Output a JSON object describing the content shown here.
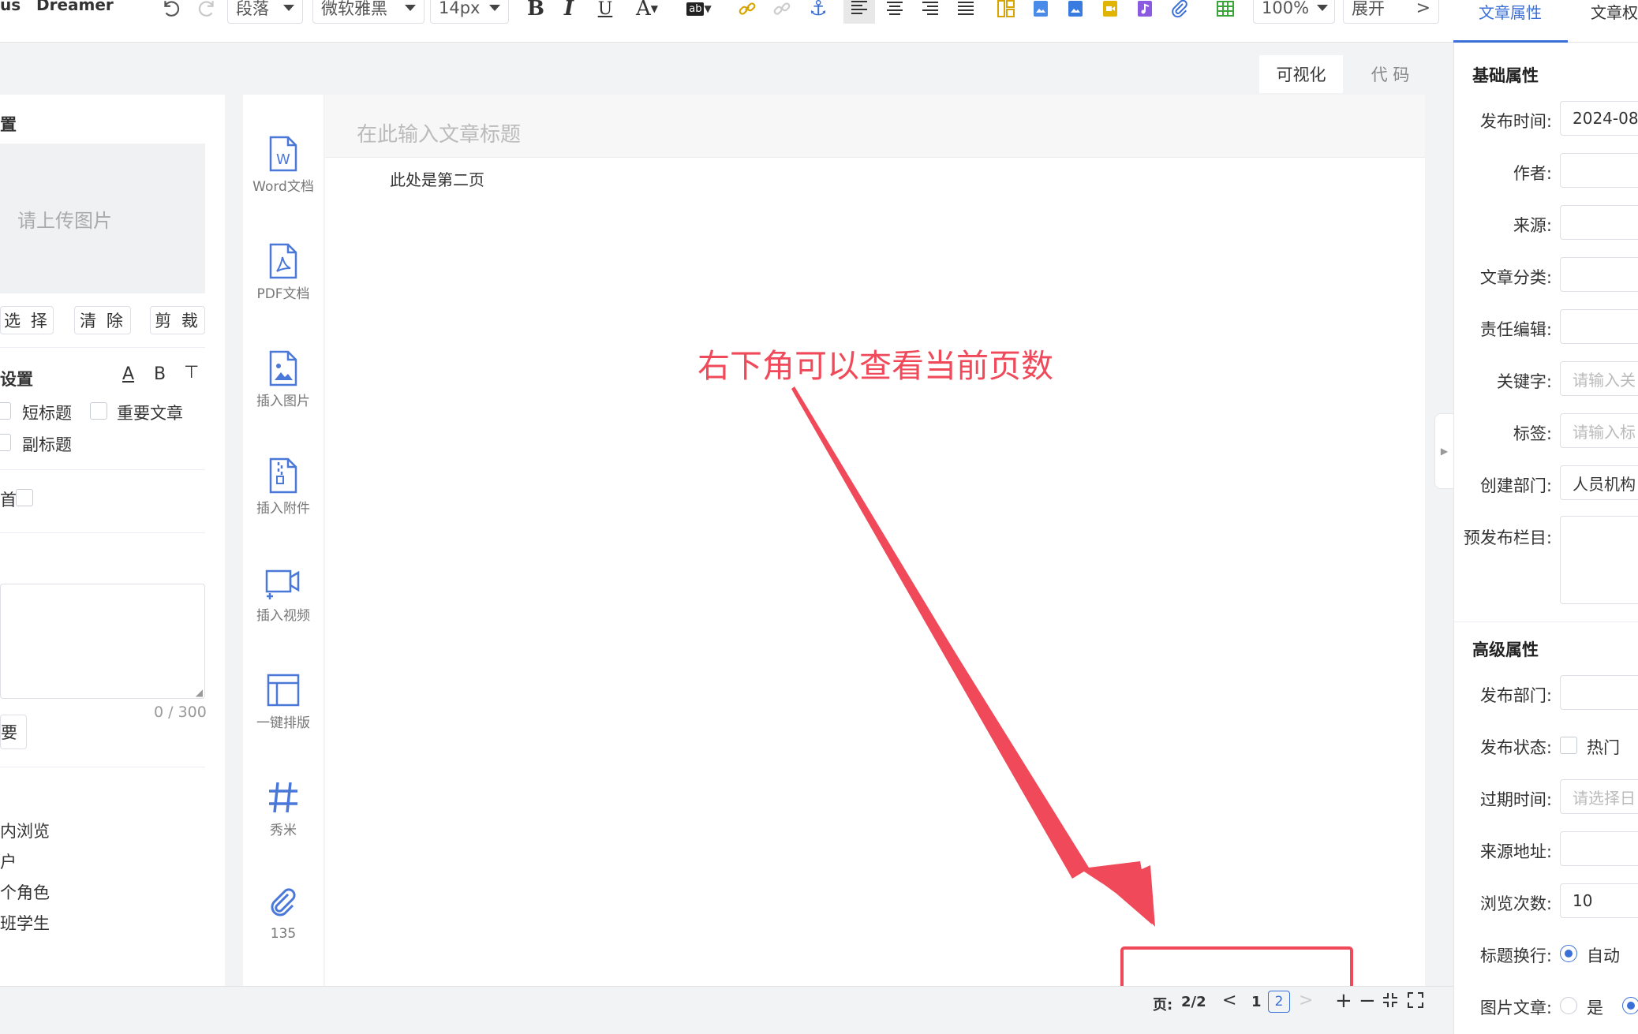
{
  "app": {
    "brand_fragment": "us",
    "brand_name": "Dreamer"
  },
  "toolbar": {
    "undo_icon": "undo-icon",
    "redo_icon": "redo-icon",
    "paragraph_select": "段落",
    "font_select": "微软雅黑",
    "size_select": "14px",
    "zoom_select": "100%",
    "expand_label": "展开",
    "accent": "#3a6fd8"
  },
  "view_tabs": {
    "visual": "可视化",
    "code": "代 码"
  },
  "left_panel": {
    "cover_heading_fragment": "置",
    "upload_placeholder": "请上传图片",
    "select_btn": "选 择",
    "clear_btn": "清 除",
    "crop_btn": "剪 裁",
    "title_settings_fragment": "设置",
    "short_title": "短标题",
    "important": "重要文章",
    "subtitle": "副标题",
    "top_fragment": "首",
    "counter": "0 / 300",
    "summary_btn_fragment": "要",
    "perm_items": [
      "内浏览",
      "户",
      "个角色",
      "班学生"
    ]
  },
  "tools": [
    {
      "name": "word-doc",
      "label": "Word文档",
      "icon": "word-icon"
    },
    {
      "name": "pdf-doc",
      "label": "PDF文档",
      "icon": "pdf-icon"
    },
    {
      "name": "insert-image",
      "label": "插入图片",
      "icon": "image-icon"
    },
    {
      "name": "insert-attachment",
      "label": "插入附件",
      "icon": "attachment-file-icon"
    },
    {
      "name": "insert-video",
      "label": "插入视频",
      "icon": "video-icon"
    },
    {
      "name": "one-click-layout",
      "label": "一键排版",
      "icon": "layout-icon"
    },
    {
      "name": "xiumi",
      "label": "秀米",
      "icon": "hash-icon"
    },
    {
      "name": "135",
      "label": "135",
      "icon": "paperclip-icon"
    }
  ],
  "editor": {
    "title_placeholder": "在此输入文章标题",
    "body_text": "此处是第二页"
  },
  "annotation": {
    "text": "右下角可以查看当前页数",
    "color": "#f04a5a"
  },
  "pager": {
    "label": "页:",
    "value": "2/2",
    "page1": "1",
    "page2": "2"
  },
  "right_tabs": {
    "active": "文章属性",
    "other": "文章权"
  },
  "right_panel": {
    "basic_heading": "基础属性",
    "advanced_heading": "高级属性",
    "fields": {
      "publish_time": {
        "label": "发布时间:",
        "value": "2024-08-"
      },
      "author": {
        "label": "作者:"
      },
      "source": {
        "label": "来源:"
      },
      "category": {
        "label": "文章分类:"
      },
      "editor": {
        "label": "责任编辑:"
      },
      "keywords": {
        "label": "关键字:",
        "placeholder": "请输入关"
      },
      "tags": {
        "label": "标签:",
        "placeholder": "请输入标"
      },
      "dept": {
        "label": "创建部门:",
        "value": "人员机构"
      },
      "pre_column": {
        "label": "预发布栏目:"
      },
      "pub_dept": {
        "label": "发布部门:"
      },
      "pub_status": {
        "label": "发布状态:",
        "option": "热门"
      },
      "expire": {
        "label": "过期时间:",
        "placeholder": "请选择日"
      },
      "source_url": {
        "label": "来源地址:"
      },
      "views": {
        "label": "浏览次数:",
        "value": "10"
      },
      "title_wrap": {
        "label": "标题换行:",
        "option": "自动"
      },
      "image_article": {
        "label": "图片文章:",
        "option": "是"
      }
    }
  }
}
